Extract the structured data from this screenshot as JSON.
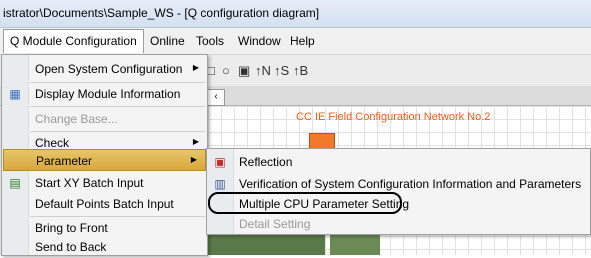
{
  "window": {
    "title": "istrator\\Documents\\Sample_WS - [Q configuration diagram]"
  },
  "menubar": {
    "items": [
      "Q Module Configuration",
      "Online",
      "Tools",
      "Window",
      "Help"
    ]
  },
  "toolbar": {
    "glyphs": [
      "□",
      "○",
      "▣",
      "↑N",
      "↑S",
      "↑B"
    ]
  },
  "canvas": {
    "network_label": "CC IE Field Configuration Network No.2"
  },
  "main_menu": {
    "items": [
      {
        "label": "Open System Configuration",
        "has_submenu": true,
        "icon": ""
      },
      {
        "label": "Display Module Information",
        "has_submenu": false,
        "icon": "module-info-icon"
      },
      {
        "label": "Change Base...",
        "disabled": true
      },
      {
        "label": "Check",
        "has_submenu": true
      },
      {
        "label": "Parameter",
        "has_submenu": true,
        "highlighted": true
      },
      {
        "label": "Start XY Batch Input",
        "icon": "xy-batch-icon"
      },
      {
        "label": "Default Points Batch Input"
      },
      {
        "label": "Bring to Front"
      },
      {
        "label": "Send to Back"
      }
    ]
  },
  "sub_menu": {
    "items": [
      {
        "label": "Reflection",
        "icon": "reflection-icon"
      },
      {
        "label": "Verification of System Configuration Information and Parameters",
        "icon": "verification-icon"
      },
      {
        "label": "Multiple CPU Parameter Setting",
        "circled": true
      },
      {
        "label": "Detail Setting",
        "disabled": true
      }
    ]
  },
  "colors": {
    "highlight": "#d8a93a",
    "network_label": "#ff5a1e",
    "module": "#f07a2a"
  }
}
